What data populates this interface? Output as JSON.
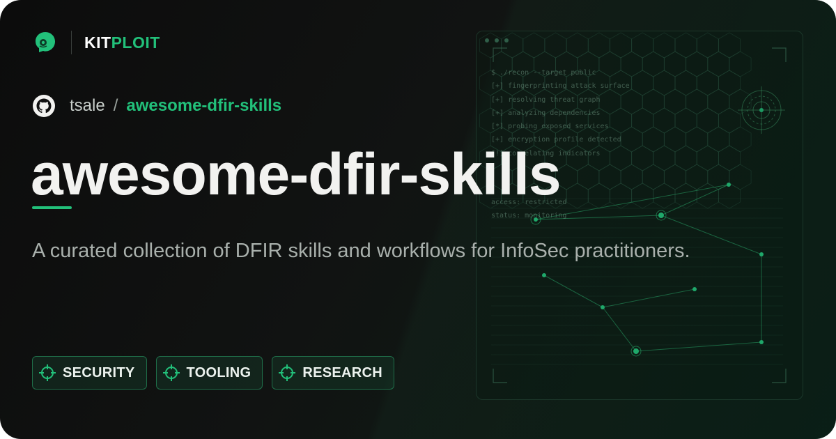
{
  "brand": {
    "kit": "KIT",
    "ploit": "PLOIT"
  },
  "breadcrumb": {
    "owner": "tsale",
    "separator": "/",
    "repo": "awesome-dfir-skills"
  },
  "title": "awesome-dfir-skills",
  "description": "A curated collection of DFIR skills and workflows for InfoSec practitioners.",
  "tags": [
    {
      "label": "SECURITY"
    },
    {
      "label": "TOOLING"
    },
    {
      "label": "RESEARCH"
    }
  ],
  "terminal": {
    "lines": [
      "$ ./recon --target public",
      "[+] fingerprinting attack surface",
      "[+] resolving threat graph",
      "[+] analyzing dependencies",
      "[*] probing exposed services",
      "[+] encryption profile detected",
      "[!] correlating indicators"
    ],
    "status_lines": [
      "access: restricted",
      "status: monitoring"
    ]
  },
  "colors": {
    "accent": "#22c07a",
    "background": "#0c0c0c",
    "title": "#f2f2f0",
    "muted": "#a9b0ac"
  },
  "icons": {
    "brand": "kitploit-mascot-icon",
    "repo_host": "github-icon",
    "tag": "crosshair-icon"
  }
}
